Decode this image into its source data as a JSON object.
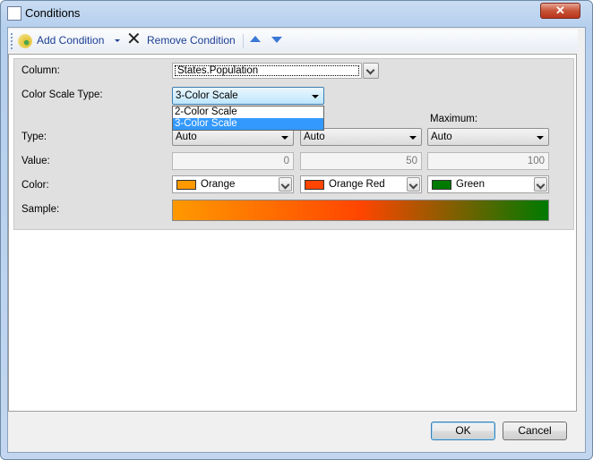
{
  "window": {
    "title": "Conditions",
    "close_label": "✕"
  },
  "toolbar": {
    "add_label": "Add Condition",
    "remove_label": "Remove Condition"
  },
  "form": {
    "column_label": "Column:",
    "column_value": "States.Population",
    "scale_type_label": "Color Scale Type:",
    "scale_type_value": "3-Color Scale",
    "scale_type_options": [
      "2-Color Scale",
      "3-Color Scale"
    ],
    "maximum_header": "Maximum:",
    "type_label": "Type:",
    "types": [
      "Auto",
      "Auto",
      "Auto"
    ],
    "value_label": "Value:",
    "values": [
      "0",
      "50",
      "100"
    ],
    "color_label": "Color:",
    "colors": [
      {
        "name": "Orange",
        "hex": "#ff9900"
      },
      {
        "name": "Orange Red",
        "hex": "#ff4500"
      },
      {
        "name": "Green",
        "hex": "#007a00"
      }
    ],
    "sample_label": "Sample:"
  },
  "buttons": {
    "ok": "OK",
    "cancel": "Cancel"
  }
}
